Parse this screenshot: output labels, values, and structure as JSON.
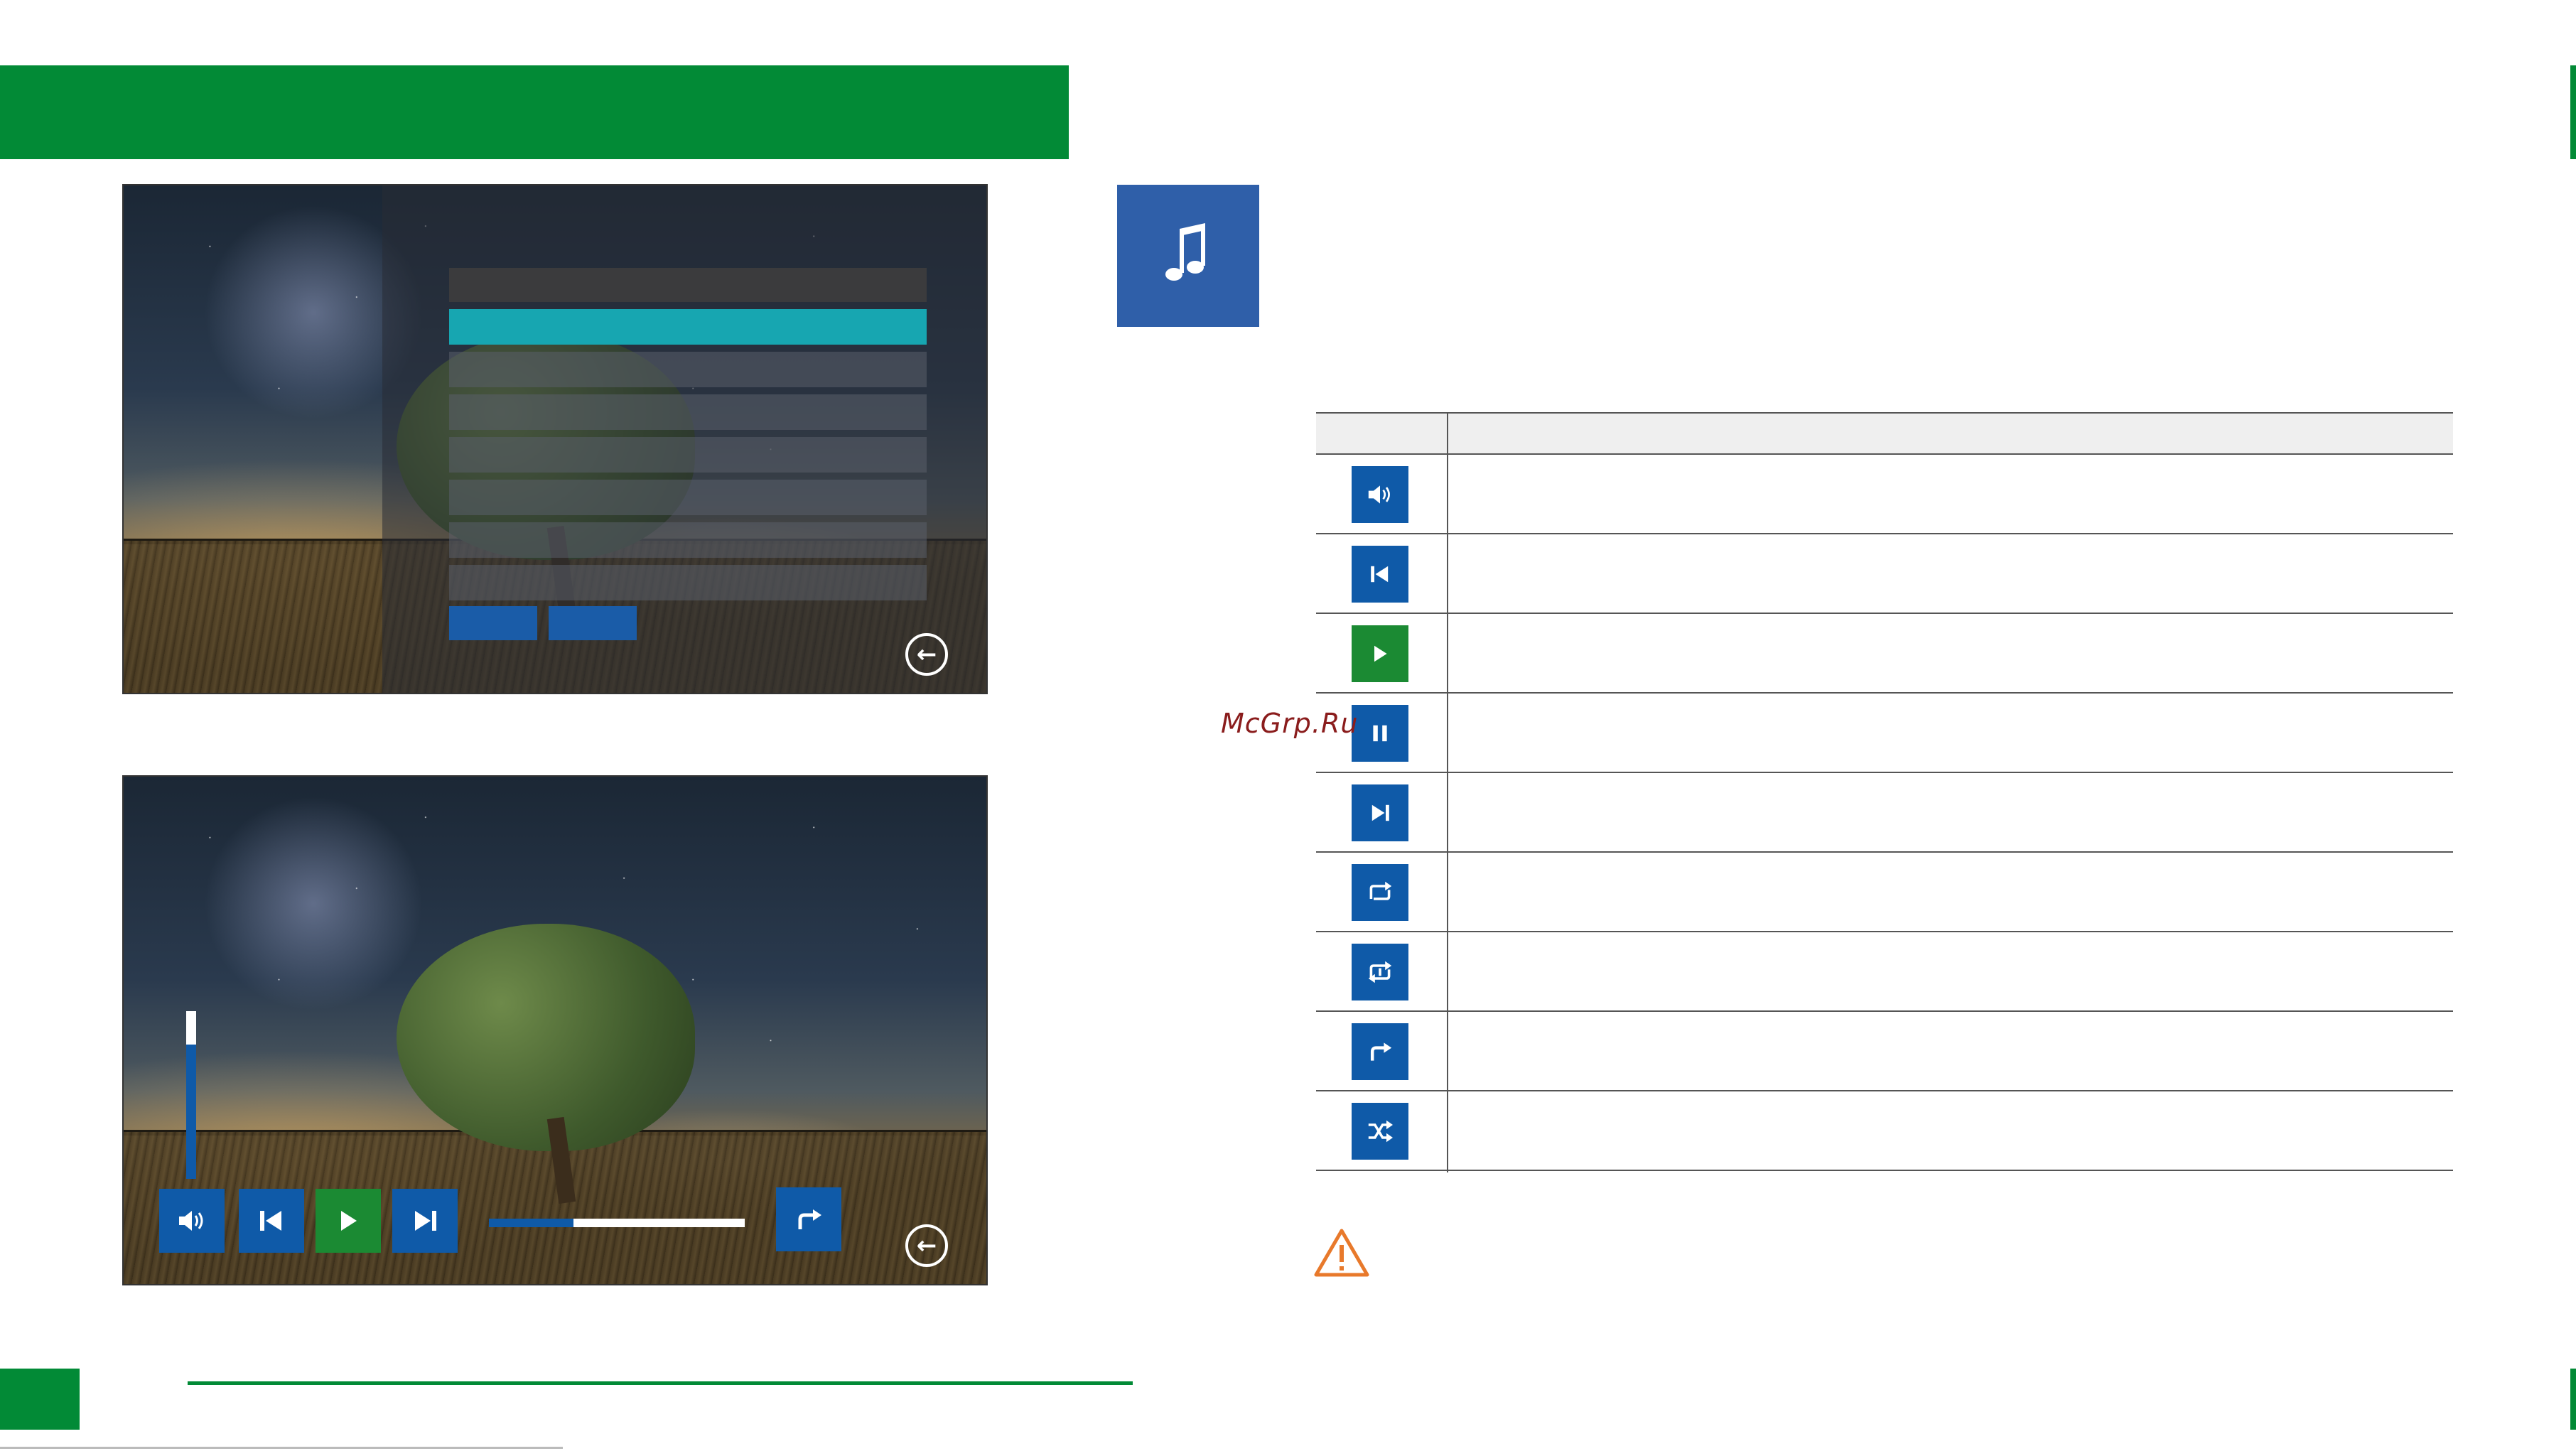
{
  "watermark": {
    "text": "McGrp.Ru"
  },
  "colors": {
    "brand_green": "#028a36",
    "control_blue": "#0f5aa8",
    "play_green": "#1b8a33",
    "menu_highlight": "#17a6b1",
    "music_tile": "#2f5fa9",
    "warning_orange": "#e8792b"
  },
  "icons": {
    "music_tile": "music-note-icon",
    "warning": "warning-triangle-icon",
    "table": [
      "volume-icon",
      "previous-track-icon",
      "play-icon",
      "pause-icon",
      "next-track-icon",
      "repeat-all-icon",
      "repeat-one-icon",
      "forward-share-icon",
      "shuffle-icon"
    ]
  },
  "player": {
    "volume_level": 0.8,
    "progress": 0.33
  }
}
